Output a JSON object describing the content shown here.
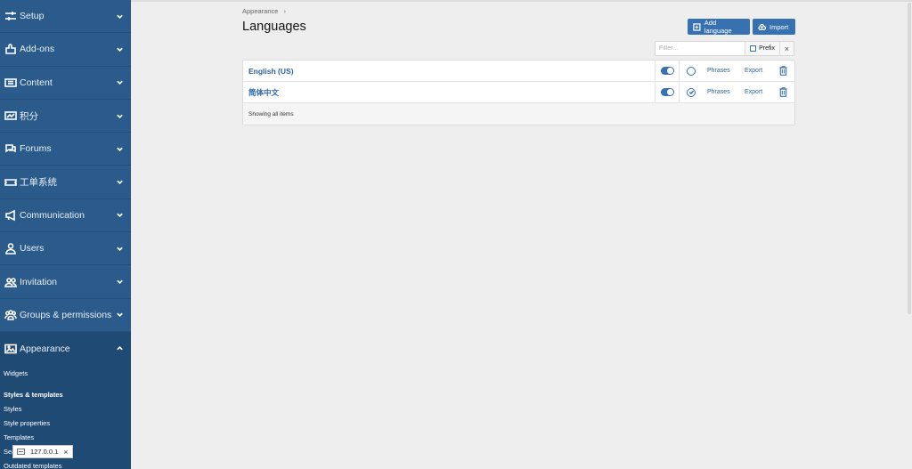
{
  "sidebar": {
    "items": [
      {
        "label": "Setup",
        "icon": "sliders-icon"
      },
      {
        "label": "Add-ons",
        "icon": "puzzle-icon"
      },
      {
        "label": "Content",
        "icon": "content-icon"
      },
      {
        "label": "积分",
        "icon": "credits-icon"
      },
      {
        "label": "Forums",
        "icon": "chat-icon"
      },
      {
        "label": "工单系统",
        "icon": "ticket-icon"
      },
      {
        "label": "Communication",
        "icon": "megaphone-icon"
      },
      {
        "label": "Users",
        "icon": "user-icon"
      },
      {
        "label": "Invitation",
        "icon": "users-icon"
      },
      {
        "label": "Groups & permissions",
        "icon": "group-icon"
      },
      {
        "label": "Appearance",
        "icon": "image-icon"
      }
    ],
    "submenu": {
      "widgets": "Widgets",
      "section_head": "Styles & templates",
      "styles": "Styles",
      "style_properties": "Style properties",
      "templates": "Templates",
      "search_partial": "Sea",
      "outdated": "Outdated templates"
    },
    "tooltip": "127.0.0.1"
  },
  "breadcrumb": {
    "parent": "Appearance",
    "separator": "›"
  },
  "page_title": "Languages",
  "buttons": {
    "add_language": "Add language",
    "import": "Import"
  },
  "filter": {
    "placeholder": "Filter...",
    "prefix_label": "Prefix",
    "clear": "×"
  },
  "languages": [
    {
      "name": "English (US)",
      "enabled": true,
      "default": false,
      "phrases": "Phrases",
      "export": "Export"
    },
    {
      "name": "简体中文",
      "enabled": true,
      "default": true,
      "phrases": "Phrases",
      "export": "Export"
    }
  ],
  "footer_text": "Showing all items",
  "colors": {
    "sidebar": "#2b5b8a",
    "accent": "#3871b0",
    "link": "#2a62a0"
  }
}
